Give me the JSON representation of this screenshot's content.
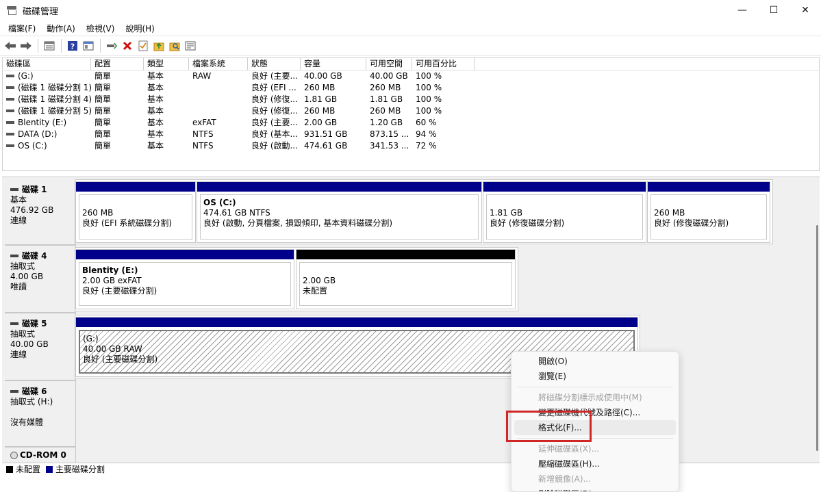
{
  "window": {
    "title": "磁碟管理",
    "minimize": "—",
    "maximize": "☐",
    "close": "✕"
  },
  "menu": [
    "檔案(F)",
    "動作(A)",
    "檢視(V)",
    "說明(H)"
  ],
  "volume_table": {
    "headers": [
      "磁碟區",
      "配置",
      "類型",
      "檔案系統",
      "狀態",
      "容量",
      "可用空間",
      "可用百分比"
    ],
    "rows": [
      [
        "(G:)",
        "簡單",
        "基本",
        "RAW",
        "良好 (主要...",
        "40.00 GB",
        "40.00 GB",
        "100 %"
      ],
      [
        "(磁碟 1 磁碟分割 1)",
        "簡單",
        "基本",
        "",
        "良好 (EFI ...",
        "260 MB",
        "260 MB",
        "100 %"
      ],
      [
        "(磁碟 1 磁碟分割 4)",
        "簡單",
        "基本",
        "",
        "良好 (修復...",
        "1.81 GB",
        "1.81 GB",
        "100 %"
      ],
      [
        "(磁碟 1 磁碟分割 5)",
        "簡單",
        "基本",
        "",
        "良好 (修復...",
        "260 MB",
        "260 MB",
        "100 %"
      ],
      [
        "Blentity (E:)",
        "簡單",
        "基本",
        "exFAT",
        "良好 (主要...",
        "2.00 GB",
        "1.20 GB",
        "60 %"
      ],
      [
        "DATA (D:)",
        "簡單",
        "基本",
        "NTFS",
        "良好 (基本...",
        "931.51 GB",
        "873.15 ...",
        "94 %"
      ],
      [
        "OS (C:)",
        "簡單",
        "基本",
        "NTFS",
        "良好 (啟動...",
        "474.61 GB",
        "341.53 ...",
        "72 %"
      ]
    ]
  },
  "disks": {
    "disk1": {
      "name": "磁碟 1",
      "type": "基本",
      "size": "476.92 GB",
      "status": "連線",
      "parts": [
        {
          "vname": "",
          "size": "260 MB",
          "status": "良好 (EFI 系統磁碟分割)"
        },
        {
          "vname": "OS  (C:)",
          "size": "474.61 GB NTFS",
          "status": "良好 (啟動, 分頁檔案, 損毀傾印, 基本資料磁碟分割)"
        },
        {
          "vname": "",
          "size": "1.81 GB",
          "status": "良好 (修復磁碟分割)"
        },
        {
          "vname": "",
          "size": "260 MB",
          "status": "良好 (修復磁碟分割)"
        }
      ]
    },
    "disk4": {
      "name": "磁碟 4",
      "type": "抽取式",
      "size": "4.00 GB",
      "status": "唯讀",
      "parts": [
        {
          "vname": "Blentity  (E:)",
          "size": "2.00 GB exFAT",
          "status": "良好 (主要磁碟分割)"
        },
        {
          "vname": "",
          "size": "2.00 GB",
          "status": "未配置"
        }
      ]
    },
    "disk5": {
      "name": "磁碟 5",
      "type": "抽取式",
      "size": "40.00 GB",
      "status": "連線",
      "parts": [
        {
          "vname": "(G:)",
          "size": "40.00 GB RAW",
          "status": "良好 (主要磁碟分割)"
        }
      ]
    },
    "disk6": {
      "name": "磁碟 6",
      "type": "抽取式 (H:)",
      "status": "沒有媒體"
    },
    "cdrom": {
      "name": "CD-ROM 0"
    }
  },
  "legend": {
    "unallocated": "未配置",
    "primary": "主要磁碟分割",
    "unallocated_color": "#000000",
    "primary_color": "#00008b"
  },
  "context_menu": {
    "items": [
      {
        "label": "開啟(O)",
        "disabled": false
      },
      {
        "label": "瀏覽(E)",
        "disabled": false
      },
      {
        "sep": true
      },
      {
        "label": "將磁碟分割標示成使用中(M)",
        "disabled": true
      },
      {
        "label": "變更磁碟機代號及路徑(C)...",
        "disabled": false
      },
      {
        "label": "格式化(F)...",
        "disabled": false,
        "hover": true
      },
      {
        "sep": true
      },
      {
        "label": "延伸磁碟區(X)...",
        "disabled": true
      },
      {
        "label": "壓縮磁碟區(H)...",
        "disabled": false
      },
      {
        "label": "新增鏡像(A)...",
        "disabled": true
      },
      {
        "label": "刪除磁碟區(D)...",
        "disabled": false
      }
    ]
  },
  "accent_highlight_color": "#d02626"
}
